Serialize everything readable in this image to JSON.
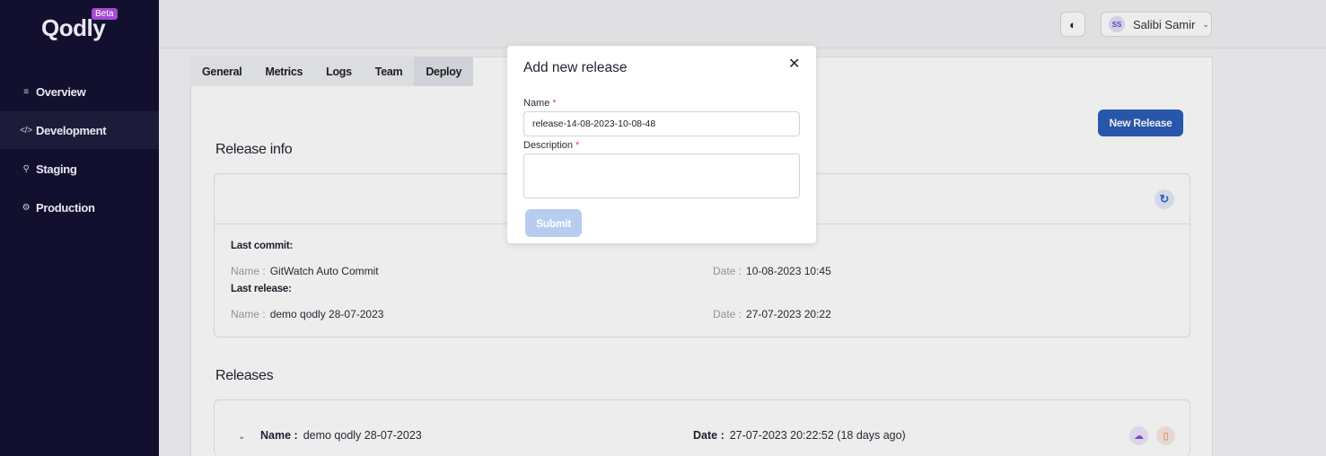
{
  "sidebar": {
    "logo": "Qodly",
    "badge": "Beta",
    "items": [
      {
        "icon": "overview-icon",
        "label": "Overview"
      },
      {
        "icon": "code-icon",
        "label": "Development"
      },
      {
        "icon": "rocket-icon",
        "label": "Staging"
      },
      {
        "icon": "gear-icon",
        "label": "Production"
      }
    ]
  },
  "topbar": {
    "user_initials": "SS",
    "user_name": "Salibi Samir"
  },
  "tabs": [
    "General",
    "Metrics",
    "Logs",
    "Team",
    "Deploy"
  ],
  "active_tab": "Deploy",
  "new_release_label": "New Release",
  "release_info": {
    "title": "Release info",
    "last_commit_label": "Last commit:",
    "last_commit_name_key": "Name :",
    "last_commit_name": "GitWatch Auto Commit",
    "last_commit_date_key": "Date :",
    "last_commit_date": "10-08-2023 10:45",
    "last_release_label": "Last release:",
    "last_release_name_key": "Name :",
    "last_release_name": "demo qodly 28-07-2023",
    "last_release_date_key": "Date :",
    "last_release_date": "27-07-2023 20:22"
  },
  "releases": {
    "title": "Releases",
    "items": [
      {
        "name_key": "Name :",
        "name": "demo qodly 28-07-2023",
        "date_key": "Date :",
        "date": "27-07-2023 20:22:52 (18 days ago)"
      }
    ]
  },
  "modal": {
    "title": "Add new release",
    "name_label": "Name",
    "name_value": "release-14-08-2023-10-08-48",
    "description_label": "Description",
    "required_marker": "*",
    "submit_label": "Submit"
  }
}
